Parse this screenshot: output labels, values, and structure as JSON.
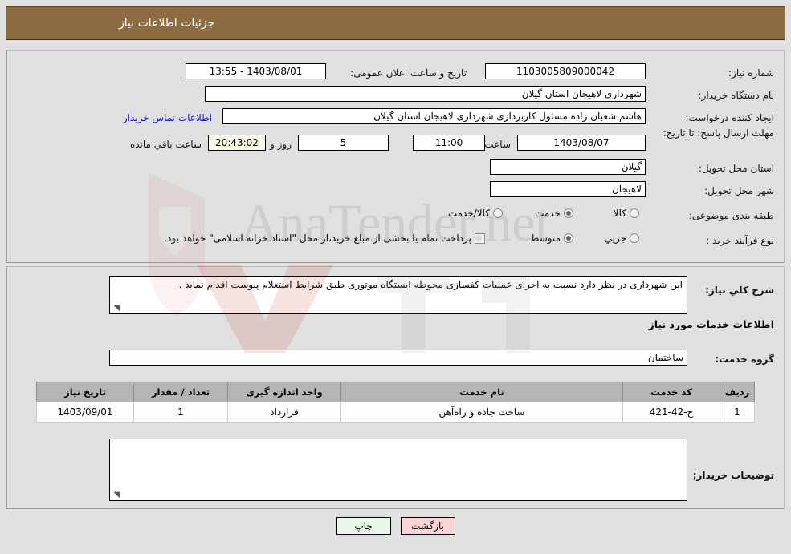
{
  "header": {
    "title": "جزئیات اطلاعات نیاز"
  },
  "form": {
    "need_number_label": "شماره نیاز:",
    "need_number_value": "1103005809000042",
    "public_announce_label": "تاریخ و ساعت اعلان عمومی:",
    "public_announce_value": "1403/08/01 - 13:55",
    "buyer_org_label": "نام دستگاه خریدار:",
    "buyer_org_value": "شهرداری لاهیجان استان گیلان",
    "requester_label": "ایجاد کننده درخواست:",
    "requester_value": "هاشم شعبان زاده مسئول کاربردازی شهرداری لاهیجان استان گیلان",
    "contact_link": "اطلاعات تماس خریدار",
    "deadline_label": "مهلت ارسال پاسخ: تا تاریخ:",
    "deadline_date": "1403/08/07",
    "hour_label": "ساعت",
    "deadline_time": "11:00",
    "days_value": "5",
    "days_label": "روز و",
    "countdown_value": "20:43:02",
    "remaining_label": "ساعت باقي مانده",
    "province_label": "استان محل تحویل:",
    "province_value": "گیلان",
    "city_label": "شهر محل تحویل:",
    "city_value": "لاهیجان",
    "category_label": "طبقه بندی موضوعی:",
    "category_options": [
      {
        "label": "کالا",
        "selected": false
      },
      {
        "label": "خدمت",
        "selected": true
      },
      {
        "label": "کالا/خدمت",
        "selected": false
      }
    ],
    "purchase_type_label": "نوع فرآیند خرید :",
    "purchase_type_options": [
      {
        "label": "جزیي",
        "selected": false
      },
      {
        "label": "متوسط",
        "selected": true
      }
    ],
    "treasury_checkbox_checked": false,
    "treasury_text": "پرداخت تمام یا بخشی از مبلغ خرید،از محل \"اسناد خزانه اسلامی\" خواهد بود."
  },
  "description": {
    "label": "شرح کلي نیاز:",
    "value": "این شهرداری در نظر دارد نسبت به اجرای عملیات کفسازی محوطه ایستگاه موتوری طبق شرایط استعلام پیوست اقدام نماید ."
  },
  "services": {
    "section_title": "اطلاعات خدمات مورد نیاز",
    "group_label": "گروه خدمت:",
    "group_value": "ساختمان",
    "table": {
      "columns": [
        "ردیف",
        "کد خدمت",
        "نام خدمت",
        "واحد اندازه گیری",
        "تعداد / مقدار",
        "تاریخ نیاز"
      ],
      "rows": [
        [
          "1",
          "ج-42-421",
          "ساخت جاده و راه‌آهن",
          "قرارداد",
          "1",
          "1403/09/01"
        ]
      ]
    }
  },
  "buyer_notes": {
    "label": "توضیحات خریدار;",
    "value": ""
  },
  "buttons": {
    "print": "چاپ",
    "back": "بازگشت"
  },
  "watermark": {
    "text": "AnaTender.net"
  },
  "colors": {
    "header_bg": "#8c6c40",
    "panel_bg": "#e0e0e0",
    "link": "#1313d8",
    "print_btn": "#e9f7e9",
    "back_btn": "#fbd5d5",
    "table_header": "#b5b5b5"
  }
}
